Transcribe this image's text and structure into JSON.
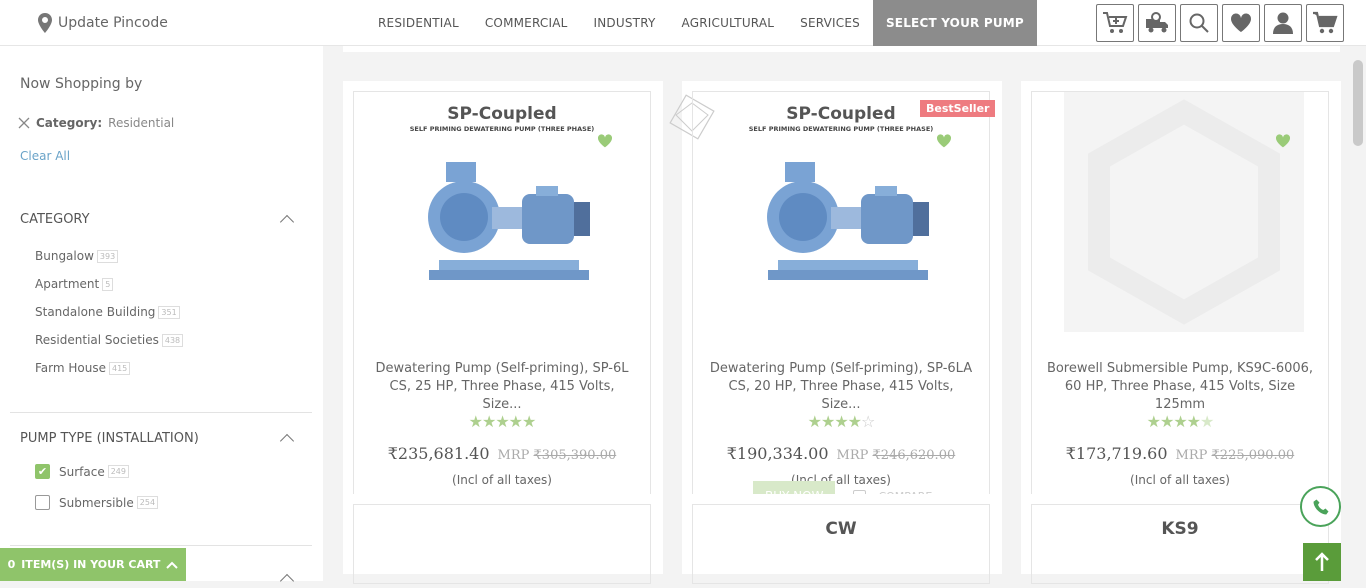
{
  "header": {
    "pincode_label": "Update Pincode",
    "nav": [
      "RESIDENTIAL",
      "COMMERCIAL",
      "INDUSTRY",
      "AGRICULTURAL",
      "SERVICES",
      "SELECT YOUR PUMP"
    ],
    "active_nav_index": 5,
    "icons": [
      "add-to-cart-icon",
      "delivery-icon",
      "search-icon",
      "heart-icon",
      "user-icon",
      "cart-icon"
    ]
  },
  "sidebar": {
    "title": "Now Shopping by",
    "active_filter": {
      "key": "Category:",
      "value": "Residential"
    },
    "clear_all": "Clear All",
    "category": {
      "title": "CATEGORY",
      "items": [
        {
          "label": "Bungalow",
          "count": "393"
        },
        {
          "label": "Apartment",
          "count": "5"
        },
        {
          "label": "Standalone Building",
          "count": "351"
        },
        {
          "label": "Residential Societies",
          "count": "438"
        },
        {
          "label": "Farm House",
          "count": "415"
        }
      ]
    },
    "pump_type": {
      "title": "PUMP TYPE (INSTALLATION)",
      "items": [
        {
          "label": "Surface",
          "count": "249",
          "checked": true
        },
        {
          "label": "Submersible",
          "count": "254",
          "checked": false
        }
      ]
    },
    "cart_bar": {
      "count": "0",
      "label": "ITEM(S) IN YOUR CART"
    }
  },
  "products": [
    {
      "brand": "SP-Coupled",
      "subtitle": "SELF PRIMING DEWATERING PUMP (THREE PHASE)",
      "name_line1": "Dewatering Pump (Self-priming), SP-6L",
      "name_line2": "CS, 25 HP, Three Phase, 415 Volts, Size...",
      "rating": 5,
      "price": "₹235,681.40",
      "mrp_label": "MRP",
      "mrp": "₹305,390.00",
      "tax_note": "(Incl of all taxes)"
    },
    {
      "brand": "SP-Coupled",
      "subtitle": "SELF PRIMING DEWATERING PUMP (THREE PHASE)",
      "badge": "BestSeller",
      "name_line1": "Dewatering Pump (Self-priming), SP-6LA",
      "name_line2": "CS, 20 HP, Three Phase, 415 Volts, Size...",
      "rating": 4,
      "price": "₹190,334.00",
      "mrp_label": "MRP",
      "mrp": "₹246,620.00",
      "tax_note": "(Incl of all taxes)",
      "buy_now": "BUY NOW",
      "compare": "COMPARE"
    },
    {
      "name_line1": "Borewell Submersible Pump, KS9C-6006,",
      "name_line2": "60 HP, Three Phase, 415 Volts, Size 125mm",
      "rating": 4.5,
      "price": "₹173,719.60",
      "mrp_label": "MRP",
      "mrp": "₹225,090.00",
      "tax_note": "(Incl of all taxes)"
    }
  ],
  "row2": [
    {
      "brand": ""
    },
    {
      "brand": "CW"
    },
    {
      "brand": "KS9"
    }
  ],
  "colors": {
    "accent": "#8fc46a",
    "badge": "#ee7b80",
    "nav_active": "#8c8c8c",
    "star": "#aed08f"
  }
}
